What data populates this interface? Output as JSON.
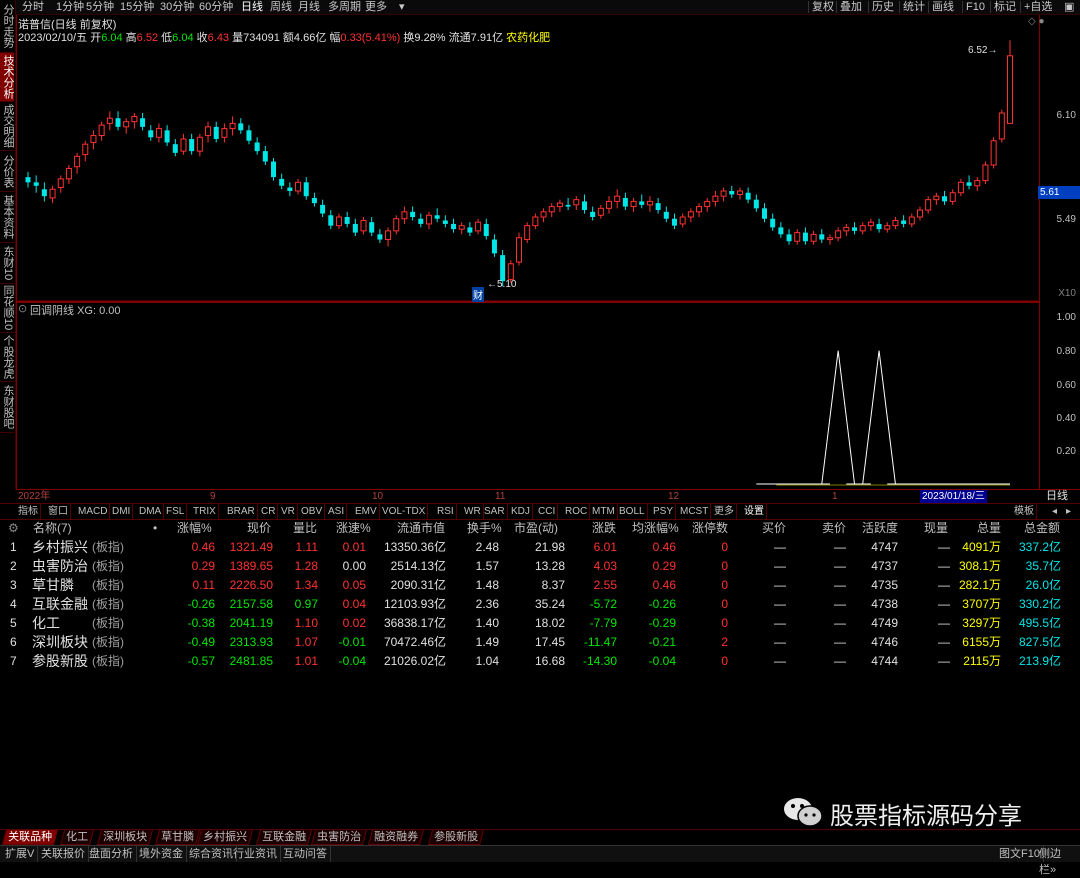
{
  "left_tabs": [
    {
      "label": "分时走势",
      "active": false
    },
    {
      "label": "技术分析",
      "active": true
    },
    {
      "label": "成交明细",
      "active": false
    },
    {
      "label": "分价表",
      "active": false
    },
    {
      "label": "基本资料",
      "active": false
    },
    {
      "label": "东财10",
      "active": false
    },
    {
      "label": "同花顺10",
      "active": false
    },
    {
      "label": "个股龙虎",
      "active": false
    },
    {
      "label": "东财股吧",
      "active": false
    }
  ],
  "period_tabs": [
    "分时",
    "1分钟",
    "5分钟",
    "15分钟",
    "30分钟",
    "60分钟",
    "日线",
    "周线",
    "月线",
    "多周期",
    "更多"
  ],
  "period_selected": "日线",
  "right_tools": [
    "复权",
    "叠加",
    "历史",
    "统计",
    "画线",
    "F10",
    "标记",
    "+自选",
    "返回"
  ],
  "stock_header": {
    "name": "诺普信",
    "mode": "(日线 前复权)",
    "date": "2023/02/10/五",
    "open_label": "开",
    "open": "6.04",
    "high_label": "高",
    "high": "6.52",
    "low_label": "低",
    "low": "6.04",
    "close_label": "收",
    "close": "6.43",
    "vol_label": "量",
    "vol": "734091",
    "amt_label": "额",
    "amt": "4.66亿",
    "chg_label": "幅",
    "chg": "0.33(5.41%)",
    "turn_label": "换",
    "turn": "9.28%",
    "float_label": "流通",
    "float": "7.91亿",
    "sector": "农药化肥"
  },
  "main_axis": {
    "labels": [
      "6.10",
      "5.49"
    ],
    "current_price": "5.61",
    "multiplier": "X10"
  },
  "annotations": {
    "high_mark": "6.52",
    "low_mark": "5.10",
    "cai": "财"
  },
  "sub_indicator": {
    "title": "回调阴线",
    "value_label": "XG: 0.00",
    "axis_labels": [
      "1.00",
      "0.80",
      "0.60",
      "0.40",
      "0.20"
    ]
  },
  "date_axis": [
    "2022年",
    "9",
    "10",
    "11",
    "12",
    "1"
  ],
  "date_cursor": "2023/01/18/三",
  "date_period": "日线",
  "indicator_tabs": [
    "指标",
    "窗口",
    "MACD",
    "DMI",
    "DMA",
    "FSL",
    "TRIX",
    "BRAR",
    "CR",
    "VR",
    "OBV",
    "ASI",
    "EMV",
    "VOL-TDX",
    "RSI",
    "WR",
    "SAR",
    "KDJ",
    "CCI",
    "ROC",
    "MTM",
    "BOLL",
    "PSY",
    "MCST",
    "更多",
    "设置"
  ],
  "indicator_right": "模板",
  "table": {
    "headers": [
      "名称(7)",
      "•",
      "涨幅%",
      "现价",
      "量比",
      "涨速%",
      "流通市值",
      "换手%",
      "市盈(动)",
      "涨跌",
      "均涨幅%",
      "涨停数",
      "买价",
      "卖价",
      "活跃度",
      "现量",
      "总量",
      "总金额"
    ],
    "rows": [
      {
        "idx": "1",
        "name": "乡村振兴",
        "tag": "(板指)",
        "chg": "0.46",
        "price": "1321.49",
        "vr": "1.11",
        "spd": "0.01",
        "fmv": "13350.36亿",
        "turn": "2.48",
        "pe": "21.98",
        "diff": "6.01",
        "avg": "0.46",
        "lim": "0",
        "bid": "—",
        "ask": "—",
        "act": "4747",
        "cur": "—",
        "vol": "4091万",
        "amt": "337.2亿",
        "dir": "up",
        "spd_dir": "up"
      },
      {
        "idx": "2",
        "name": "虫害防治",
        "tag": "(板指)",
        "chg": "0.29",
        "price": "1389.65",
        "vr": "1.28",
        "spd": "0.00",
        "fmv": "2514.13亿",
        "turn": "1.57",
        "pe": "13.28",
        "diff": "4.03",
        "avg": "0.29",
        "lim": "0",
        "bid": "—",
        "ask": "—",
        "act": "4737",
        "cur": "—",
        "vol": "308.1万",
        "amt": "35.7亿",
        "dir": "up",
        "spd_dir": "flat"
      },
      {
        "idx": "3",
        "name": "草甘膦",
        "tag": "(板指)",
        "chg": "0.11",
        "price": "2226.50",
        "vr": "1.34",
        "spd": "0.05",
        "fmv": "2090.31亿",
        "turn": "1.48",
        "pe": "8.37",
        "diff": "2.55",
        "avg": "0.46",
        "lim": "0",
        "bid": "—",
        "ask": "—",
        "act": "4735",
        "cur": "—",
        "vol": "282.1万",
        "amt": "26.0亿",
        "dir": "up",
        "spd_dir": "up"
      },
      {
        "idx": "4",
        "name": "互联金融",
        "tag": "(板指)",
        "chg": "-0.26",
        "price": "2157.58",
        "vr": "0.97",
        "spd": "0.04",
        "fmv": "12103.93亿",
        "turn": "2.36",
        "pe": "35.24",
        "diff": "-5.72",
        "avg": "-0.26",
        "lim": "0",
        "bid": "—",
        "ask": "—",
        "act": "4738",
        "cur": "—",
        "vol": "3707万",
        "amt": "330.2亿",
        "dir": "down",
        "spd_dir": "up"
      },
      {
        "idx": "5",
        "name": "化工",
        "tag": "(板指)",
        "chg": "-0.38",
        "price": "2041.19",
        "vr": "1.10",
        "spd": "0.02",
        "fmv": "36838.17亿",
        "turn": "1.40",
        "pe": "18.02",
        "diff": "-7.79",
        "avg": "-0.29",
        "lim": "0",
        "bid": "—",
        "ask": "—",
        "act": "4749",
        "cur": "—",
        "vol": "3297万",
        "amt": "495.5亿",
        "dir": "down",
        "spd_dir": "up"
      },
      {
        "idx": "6",
        "name": "深圳板块",
        "tag": "(板指)",
        "chg": "-0.49",
        "price": "2313.93",
        "vr": "1.07",
        "spd": "-0.01",
        "fmv": "70472.46亿",
        "turn": "1.49",
        "pe": "17.45",
        "diff": "-11.47",
        "avg": "-0.21",
        "lim": "2",
        "bid": "—",
        "ask": "—",
        "act": "4746",
        "cur": "—",
        "vol": "6155万",
        "amt": "827.5亿",
        "dir": "down",
        "spd_dir": "down"
      },
      {
        "idx": "7",
        "name": "参股新股",
        "tag": "(板指)",
        "chg": "-0.57",
        "price": "2481.85",
        "vr": "1.01",
        "spd": "-0.04",
        "fmv": "21026.02亿",
        "turn": "1.04",
        "pe": "16.68",
        "diff": "-14.30",
        "avg": "-0.04",
        "lim": "0",
        "bid": "—",
        "ask": "—",
        "act": "4744",
        "cur": "—",
        "vol": "2115万",
        "amt": "213.9亿",
        "dir": "down",
        "spd_dir": "down"
      }
    ]
  },
  "bottom_tabs": [
    "关联品种",
    "化工",
    "深圳板块",
    "草甘膦",
    "乡村振兴",
    "互联金融",
    "虫害防治",
    "融资融券",
    "参股新股"
  ],
  "status_bar": [
    "扩展V",
    "关联报价",
    "盘面分析",
    "境外资金",
    "综合资讯",
    "行业资讯",
    "互动问答"
  ],
  "status_right": [
    "图文F10",
    "侧边栏»"
  ],
  "watermark": "股票指标源码分享",
  "colors": {
    "up": "#ff3232",
    "down": "#00e6e6",
    "frame": "#800000"
  },
  "chart_data": {
    "type": "candlestick",
    "candles": [
      [
        5.73,
        5.76,
        5.67,
        5.7
      ],
      [
        5.7,
        5.74,
        5.64,
        5.68
      ],
      [
        5.66,
        5.7,
        5.59,
        5.62
      ],
      [
        5.61,
        5.68,
        5.58,
        5.66
      ],
      [
        5.67,
        5.74,
        5.64,
        5.72
      ],
      [
        5.72,
        5.8,
        5.69,
        5.78
      ],
      [
        5.79,
        5.87,
        5.75,
        5.85
      ],
      [
        5.86,
        5.94,
        5.82,
        5.92
      ],
      [
        5.93,
        6.0,
        5.89,
        5.97
      ],
      [
        5.97,
        6.05,
        5.94,
        6.03
      ],
      [
        6.04,
        6.11,
        6.0,
        6.07
      ],
      [
        6.07,
        6.11,
        6.0,
        6.02
      ],
      [
        6.02,
        6.07,
        5.98,
        6.05
      ],
      [
        6.05,
        6.1,
        6.01,
        6.08
      ],
      [
        6.07,
        6.1,
        6.0,
        6.02
      ],
      [
        6.0,
        6.03,
        5.94,
        5.96
      ],
      [
        5.96,
        6.04,
        5.93,
        6.01
      ],
      [
        6.0,
        6.03,
        5.91,
        5.93
      ],
      [
        5.92,
        5.95,
        5.85,
        5.87
      ],
      [
        5.88,
        5.98,
        5.86,
        5.95
      ],
      [
        5.95,
        5.98,
        5.86,
        5.88
      ],
      [
        5.88,
        5.98,
        5.85,
        5.96
      ],
      [
        5.97,
        6.05,
        5.93,
        6.02
      ],
      [
        6.02,
        6.05,
        5.93,
        5.95
      ],
      [
        5.96,
        6.04,
        5.93,
        6.01
      ],
      [
        6.01,
        6.08,
        5.97,
        6.04
      ],
      [
        6.04,
        6.07,
        5.98,
        6.0
      ],
      [
        6.0,
        6.03,
        5.92,
        5.94
      ],
      [
        5.93,
        5.96,
        5.86,
        5.88
      ],
      [
        5.88,
        5.91,
        5.8,
        5.82
      ],
      [
        5.82,
        5.84,
        5.71,
        5.73
      ],
      [
        5.72,
        5.75,
        5.66,
        5.68
      ],
      [
        5.67,
        5.7,
        5.62,
        5.65
      ],
      [
        5.65,
        5.72,
        5.63,
        5.7
      ],
      [
        5.7,
        5.73,
        5.6,
        5.62
      ],
      [
        5.61,
        5.64,
        5.56,
        5.58
      ],
      [
        5.57,
        5.6,
        5.5,
        5.52
      ],
      [
        5.51,
        5.54,
        5.43,
        5.45
      ],
      [
        5.45,
        5.52,
        5.43,
        5.5
      ],
      [
        5.5,
        5.53,
        5.44,
        5.46
      ],
      [
        5.46,
        5.49,
        5.39,
        5.41
      ],
      [
        5.42,
        5.5,
        5.4,
        5.48
      ],
      [
        5.47,
        5.5,
        5.39,
        5.41
      ],
      [
        5.4,
        5.43,
        5.35,
        5.37
      ],
      [
        5.37,
        5.44,
        5.33,
        5.42
      ],
      [
        5.42,
        5.51,
        5.4,
        5.49
      ],
      [
        5.49,
        5.56,
        5.46,
        5.53
      ],
      [
        5.53,
        5.56,
        5.48,
        5.5
      ],
      [
        5.49,
        5.52,
        5.44,
        5.46
      ],
      [
        5.46,
        5.53,
        5.43,
        5.51
      ],
      [
        5.51,
        5.55,
        5.47,
        5.49
      ],
      [
        5.48,
        5.51,
        5.44,
        5.46
      ],
      [
        5.46,
        5.49,
        5.41,
        5.43
      ],
      [
        5.43,
        5.47,
        5.4,
        5.45
      ],
      [
        5.44,
        5.47,
        5.39,
        5.41
      ],
      [
        5.42,
        5.49,
        5.4,
        5.47
      ],
      [
        5.46,
        5.49,
        5.37,
        5.39
      ],
      [
        5.37,
        5.4,
        5.27,
        5.29
      ],
      [
        5.28,
        5.31,
        5.1,
        5.13
      ],
      [
        5.14,
        5.25,
        5.12,
        5.23
      ],
      [
        5.24,
        5.41,
        5.22,
        5.38
      ],
      [
        5.37,
        5.47,
        5.35,
        5.45
      ],
      [
        5.45,
        5.52,
        5.43,
        5.5
      ],
      [
        5.5,
        5.55,
        5.47,
        5.53
      ],
      [
        5.53,
        5.58,
        5.5,
        5.56
      ],
      [
        5.56,
        5.6,
        5.53,
        5.58
      ],
      [
        5.57,
        5.61,
        5.54,
        5.56
      ],
      [
        5.57,
        5.62,
        5.54,
        5.6
      ],
      [
        5.59,
        5.63,
        5.52,
        5.54
      ],
      [
        5.53,
        5.56,
        5.48,
        5.5
      ],
      [
        5.51,
        5.57,
        5.49,
        5.55
      ],
      [
        5.55,
        5.62,
        5.52,
        5.59
      ],
      [
        5.59,
        5.66,
        5.55,
        5.62
      ],
      [
        5.61,
        5.64,
        5.54,
        5.56
      ],
      [
        5.56,
        5.61,
        5.53,
        5.59
      ],
      [
        5.59,
        5.63,
        5.55,
        5.57
      ],
      [
        5.57,
        5.62,
        5.53,
        5.59
      ],
      [
        5.58,
        5.61,
        5.52,
        5.54
      ],
      [
        5.53,
        5.56,
        5.47,
        5.49
      ],
      [
        5.49,
        5.52,
        5.43,
        5.45
      ],
      [
        5.46,
        5.52,
        5.44,
        5.5
      ],
      [
        5.5,
        5.55,
        5.47,
        5.53
      ],
      [
        5.53,
        5.58,
        5.5,
        5.56
      ],
      [
        5.56,
        5.61,
        5.53,
        5.59
      ],
      [
        5.59,
        5.65,
        5.56,
        5.62
      ],
      [
        5.62,
        5.67,
        5.59,
        5.65
      ],
      [
        5.65,
        5.68,
        5.61,
        5.63
      ],
      [
        5.63,
        5.67,
        5.6,
        5.65
      ],
      [
        5.64,
        5.67,
        5.58,
        5.6
      ],
      [
        5.6,
        5.63,
        5.53,
        5.55
      ],
      [
        5.55,
        5.58,
        5.47,
        5.49
      ],
      [
        5.49,
        5.52,
        5.42,
        5.44
      ],
      [
        5.44,
        5.47,
        5.38,
        5.4
      ],
      [
        5.4,
        5.43,
        5.34,
        5.36
      ],
      [
        5.36,
        5.43,
        5.34,
        5.41
      ],
      [
        5.41,
        5.44,
        5.34,
        5.36
      ],
      [
        5.36,
        5.42,
        5.34,
        5.4
      ],
      [
        5.4,
        5.43,
        5.35,
        5.37
      ],
      [
        5.37,
        5.4,
        5.34,
        5.38
      ],
      [
        5.38,
        5.44,
        5.36,
        5.42
      ],
      [
        5.42,
        5.46,
        5.39,
        5.44
      ],
      [
        5.44,
        5.47,
        5.4,
        5.42
      ],
      [
        5.42,
        5.47,
        5.4,
        5.45
      ],
      [
        5.45,
        5.49,
        5.42,
        5.47
      ],
      [
        5.46,
        5.49,
        5.41,
        5.43
      ],
      [
        5.43,
        5.47,
        5.41,
        5.45
      ],
      [
        5.45,
        5.5,
        5.43,
        5.48
      ],
      [
        5.48,
        5.51,
        5.44,
        5.46
      ],
      [
        5.46,
        5.52,
        5.44,
        5.5
      ],
      [
        5.5,
        5.56,
        5.48,
        5.54
      ],
      [
        5.54,
        5.62,
        5.52,
        5.6
      ],
      [
        5.6,
        5.64,
        5.57,
        5.62
      ],
      [
        5.62,
        5.65,
        5.57,
        5.59
      ],
      [
        5.59,
        5.66,
        5.57,
        5.64
      ],
      [
        5.64,
        5.72,
        5.62,
        5.7
      ],
      [
        5.7,
        5.74,
        5.66,
        5.68
      ],
      [
        5.68,
        5.73,
        5.65,
        5.71
      ],
      [
        5.71,
        5.82,
        5.69,
        5.8
      ],
      [
        5.8,
        5.96,
        5.78,
        5.94
      ],
      [
        5.95,
        6.12,
        5.93,
        6.1
      ],
      [
        6.04,
        6.52,
        6.04,
        6.43
      ]
    ],
    "ylim": [
      5.05,
      6.55
    ],
    "sub_series": {
      "name": "XG",
      "spikes_at_index": [
        99,
        104
      ],
      "ylim": [
        0,
        1.05
      ]
    }
  }
}
